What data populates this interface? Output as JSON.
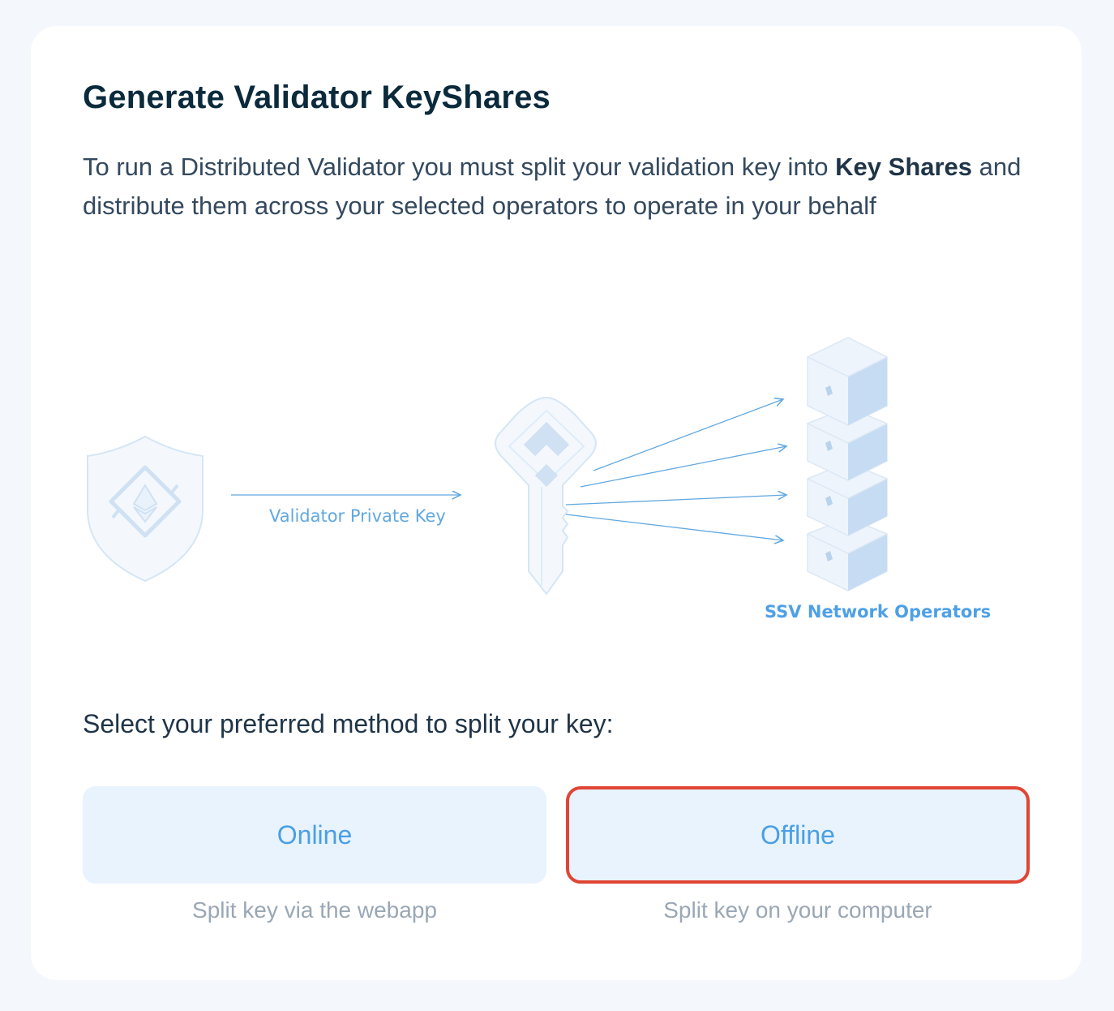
{
  "card": {
    "title": "Generate Validator KeyShares",
    "description_part1": "To run a Distributed Validator you must split your validation key into ",
    "description_bold": "Key Shares",
    "description_part2": " and distribute them across your selected operators to operate in your behalf"
  },
  "diagram": {
    "arrow_label": "Validator Private Key",
    "operators_label": "SSV Network Operators",
    "icons": [
      "shield-ethereum-icon",
      "key-icon",
      "operator-server-icon"
    ]
  },
  "method": {
    "prompt": "Select your preferred method to split your key:",
    "options": [
      {
        "label": "Online",
        "caption": "Split key via the webapp"
      },
      {
        "label": "Offline",
        "caption": "Split key on your computer"
      }
    ]
  },
  "colors": {
    "accent": "#4a9fe6",
    "highlight_border": "#e04533",
    "button_bg": "#e8f3fd"
  }
}
